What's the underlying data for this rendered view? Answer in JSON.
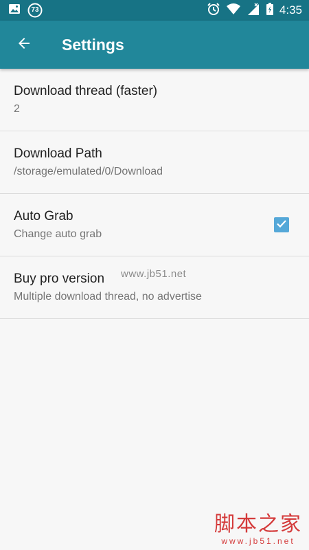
{
  "status_bar": {
    "time": "4:35",
    "notification_badge": "73",
    "icons": [
      "image-icon",
      "badge-icon",
      "alarm-icon",
      "wifi-icon",
      "signal-icon",
      "battery-icon"
    ]
  },
  "app_bar": {
    "title": "Settings",
    "back_icon": "arrow-left-icon",
    "color": "#21879a"
  },
  "settings": [
    {
      "title": "Download thread (faster)",
      "summary": "2"
    },
    {
      "title": "Download Path",
      "summary": "/storage/emulated/0/Download"
    },
    {
      "title": "Auto Grab",
      "summary": "Change auto grab",
      "checked": true
    },
    {
      "title": "Buy pro version",
      "summary": "Multiple download thread, no advertise"
    }
  ],
  "watermark": {
    "text": "www.jb51.net",
    "logo_text": "脚本之家",
    "logo_url": "www.jb51.net"
  },
  "colors": {
    "status_bar": "#177385",
    "checkbox": "#55a8d8",
    "background": "#f7f7f7"
  }
}
